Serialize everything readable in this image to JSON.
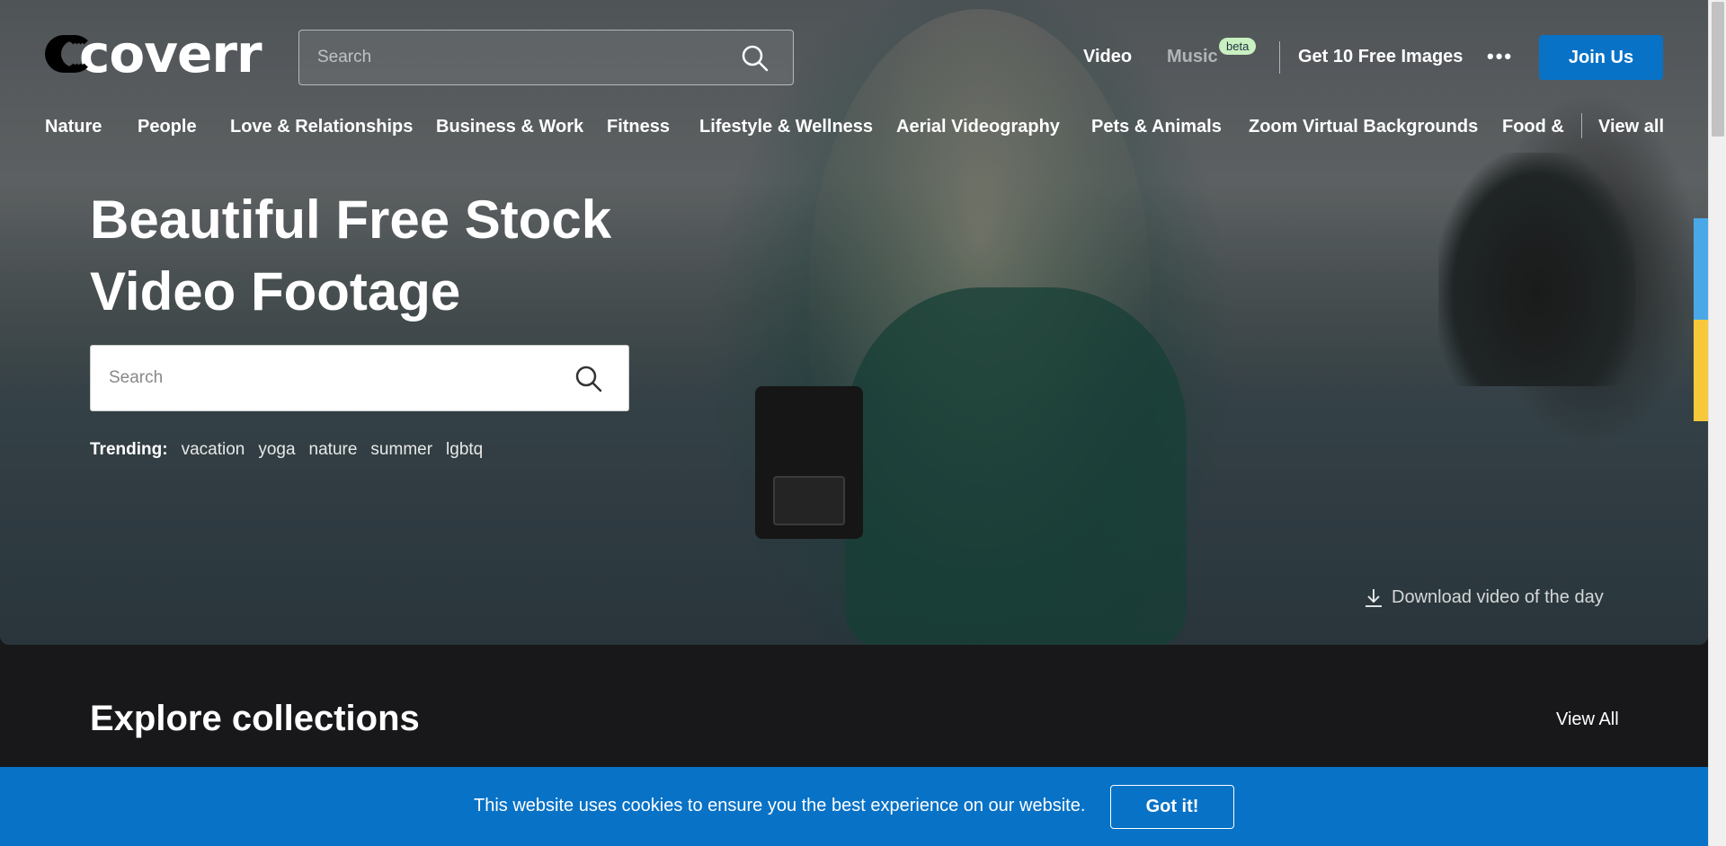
{
  "logo": {
    "text": "coverr"
  },
  "header": {
    "search_placeholder": "Search",
    "nav": {
      "video": "Video",
      "music": "Music",
      "beta": "beta",
      "free_images": "Get 10 Free Images",
      "more": "•••"
    },
    "join": "Join Us"
  },
  "categories": [
    "Nature",
    "People",
    "Love & Relationships",
    "Business & Work",
    "Fitness",
    "Lifestyle & Wellness",
    "Aerial Videography",
    "Pets & Animals",
    "Zoom Virtual Backgrounds",
    "Food &"
  ],
  "view_all_categories": "View all",
  "hero": {
    "title_line1": "Beautiful Free Stock",
    "title_line2": "Video Footage",
    "search_placeholder": "Search",
    "trending_label": "Trending:",
    "trending": [
      "vacation",
      "yoga",
      "nature",
      "summer",
      "lgbtq"
    ],
    "download": "Download video of the day"
  },
  "collections": {
    "title": "Explore collections",
    "view_all": "View All"
  },
  "cookie": {
    "message": "This website uses cookies to ensure you the best experience on our website.",
    "button": "Got it!"
  },
  "colors": {
    "brand_blue": "#0872c6",
    "beta_badge": "#c9f0c0",
    "dark_bg": "#18181b"
  }
}
